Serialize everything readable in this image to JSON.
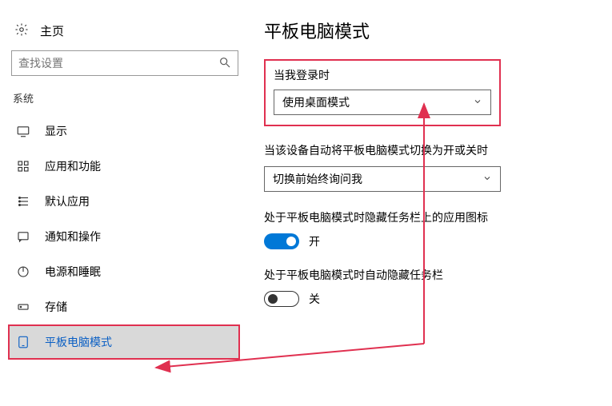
{
  "sidebar": {
    "home_label": "主页",
    "search_placeholder": "查找设置",
    "group_title": "系统",
    "items": [
      {
        "icon": "display-icon",
        "label": "显示"
      },
      {
        "icon": "apps-icon",
        "label": "应用和功能"
      },
      {
        "icon": "default-apps-icon",
        "label": "默认应用"
      },
      {
        "icon": "notifications-icon",
        "label": "通知和操作"
      },
      {
        "icon": "power-icon",
        "label": "电源和睡眠"
      },
      {
        "icon": "storage-icon",
        "label": "存储"
      },
      {
        "icon": "tablet-mode-icon",
        "label": "平板电脑模式"
      }
    ]
  },
  "content": {
    "title": "平板电脑模式",
    "signin_label": "当我登录时",
    "signin_value": "使用桌面模式",
    "auto_switch_label": "当该设备自动将平板电脑模式切换为开或关时",
    "auto_switch_value": "切换前始终询问我",
    "hide_icons_label": "处于平板电脑模式时隐藏任务栏上的应用图标",
    "hide_icons_state": "开",
    "hide_taskbar_label": "处于平板电脑模式时自动隐藏任务栏",
    "hide_taskbar_state": "关"
  }
}
